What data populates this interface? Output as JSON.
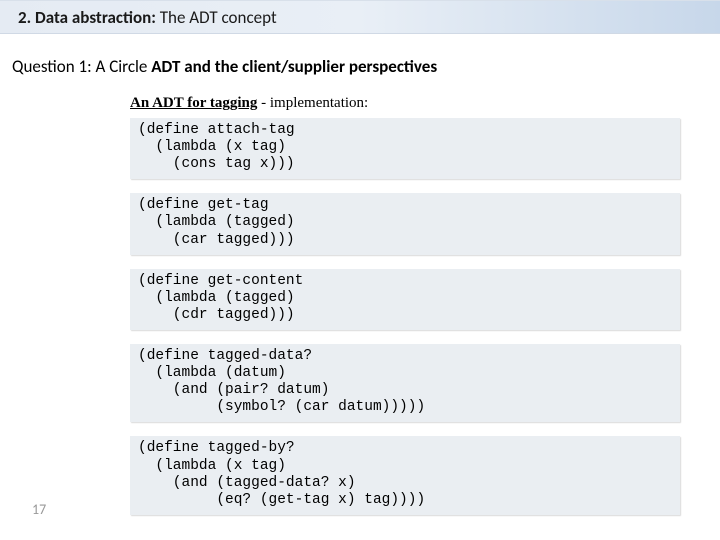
{
  "header": {
    "prefix": "2. Data abstraction:",
    "suffix": " The ADT concept"
  },
  "question": {
    "label": "Question 1: ",
    "text_plain_pre": " A Circle ",
    "text_bold_mid": "ADT and the client/supplier perspectives"
  },
  "subtitle": {
    "underlined": "An ADT for tagging",
    "rest": " - implementation:"
  },
  "code_blocks": [
    "(define attach-tag\n  (lambda (x tag)\n    (cons tag x)))",
    "(define get-tag\n  (lambda (tagged)\n    (car tagged)))",
    "(define get-content\n  (lambda (tagged)\n    (cdr tagged)))",
    "(define tagged-data?\n  (lambda (datum)\n    (and (pair? datum)\n         (symbol? (car datum)))))",
    "(define tagged-by?\n  (lambda (x tag)\n    (and (tagged-data? x)\n         (eq? (get-tag x) tag))))"
  ],
  "slide_number": "17"
}
